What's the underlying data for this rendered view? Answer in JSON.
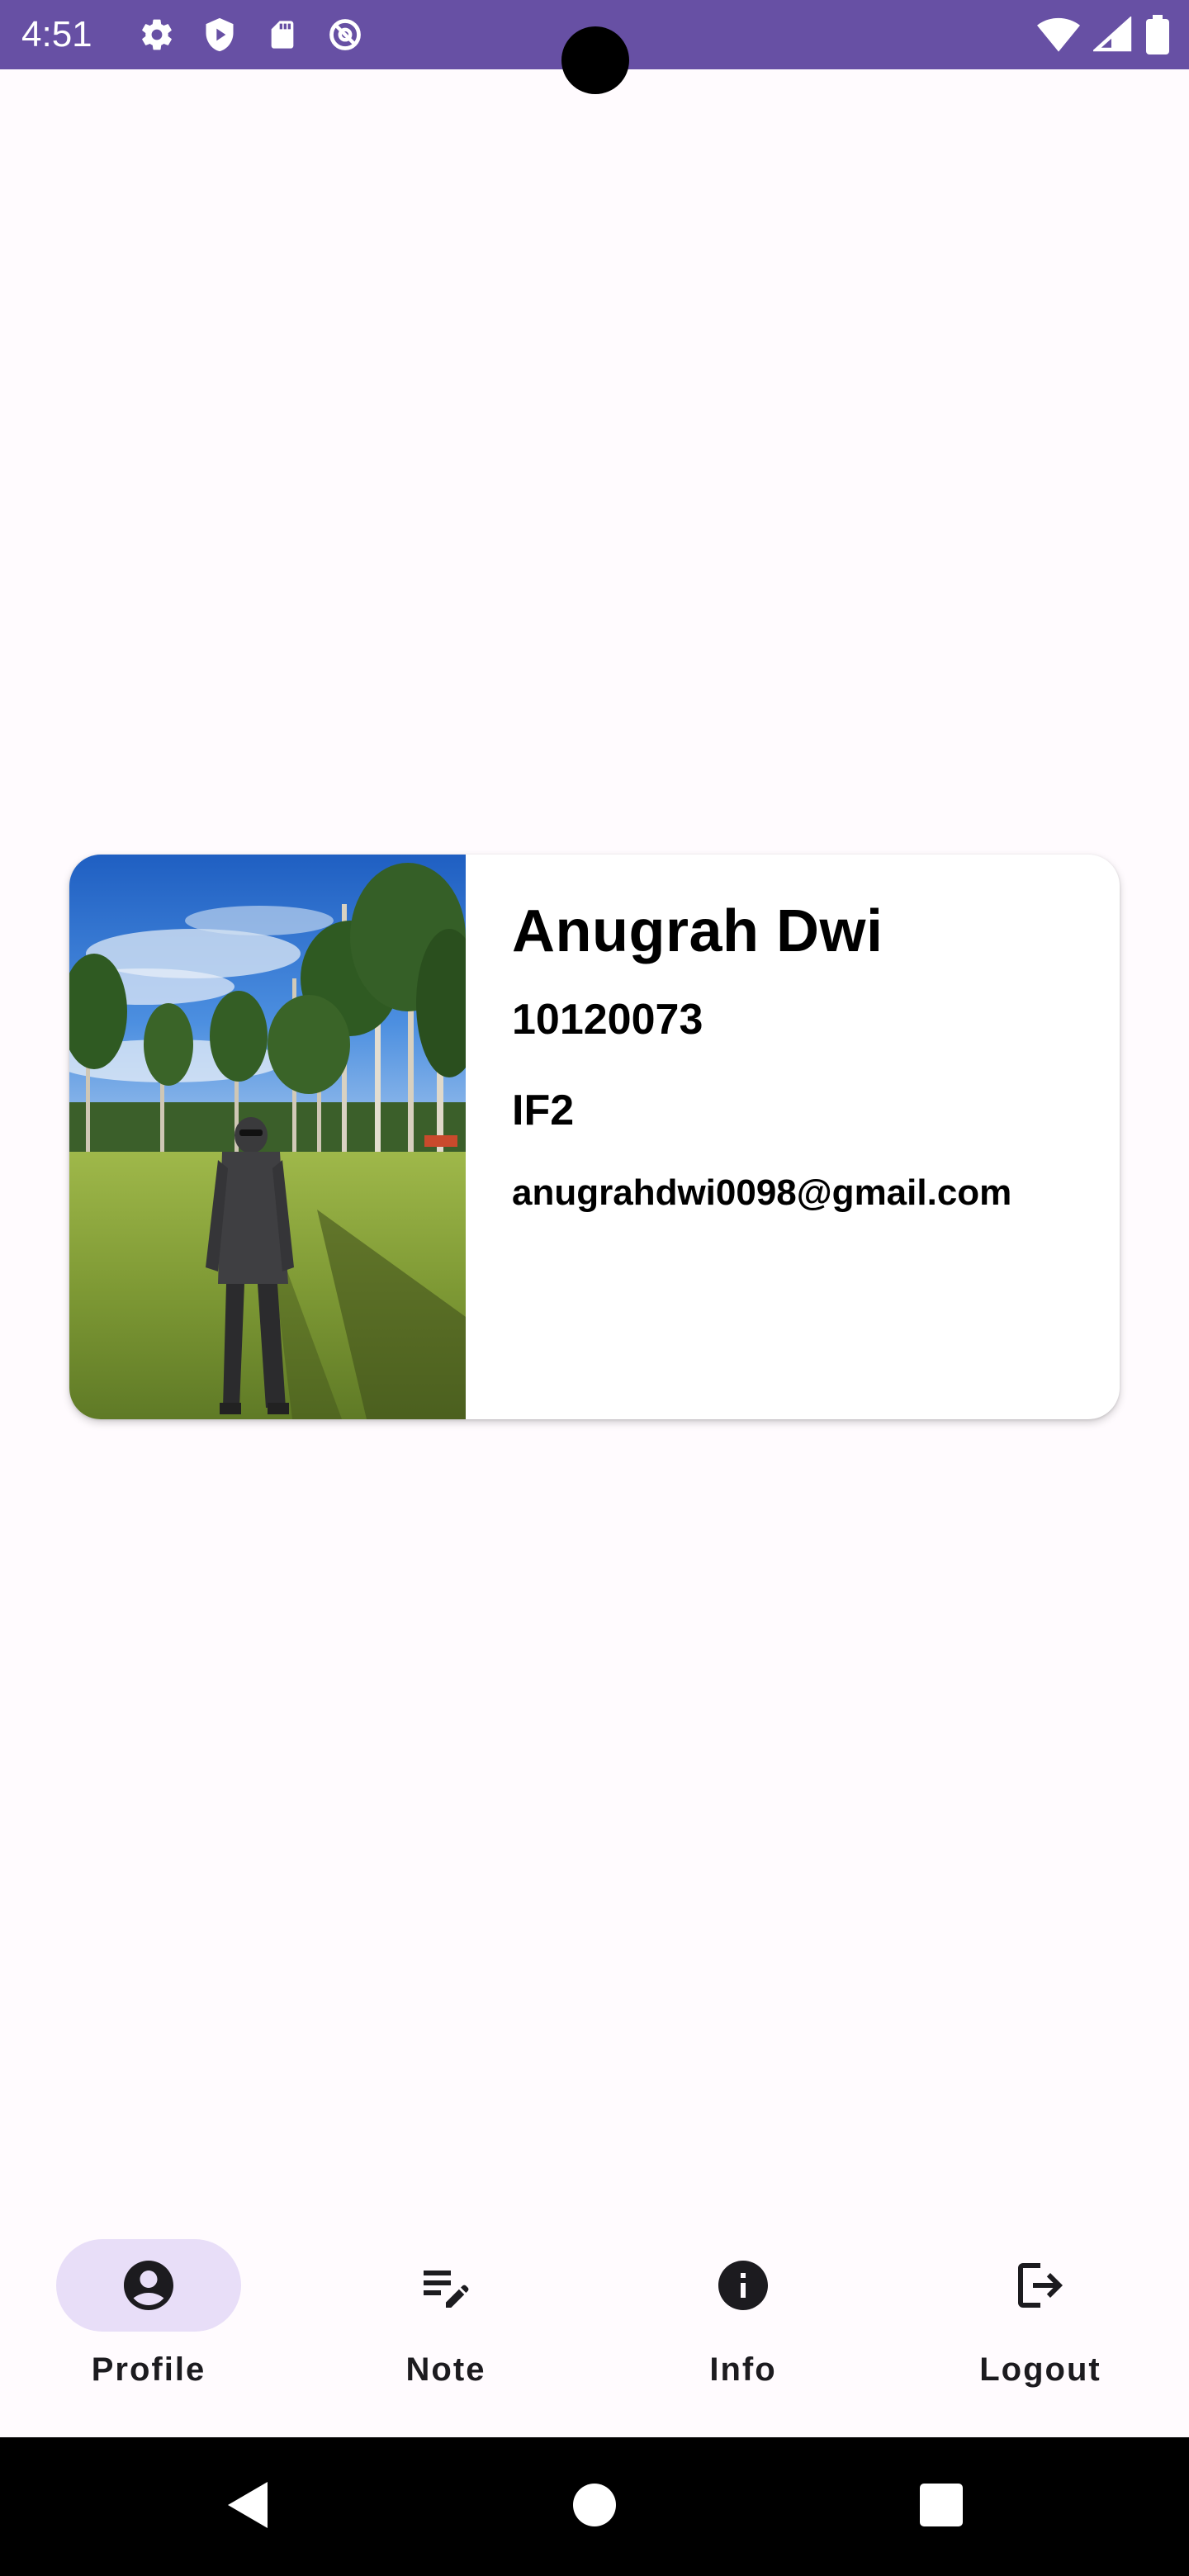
{
  "status_bar": {
    "time": "4:51",
    "icons_left": [
      "gear-icon",
      "shield-icon",
      "sd-card-icon",
      "at-sign-icon"
    ],
    "icons_right": [
      "wifi-icon",
      "signal-icon",
      "battery-icon"
    ],
    "background": "#6750a4"
  },
  "profile": {
    "name": "Anugrah Dwi",
    "nim": "10120073",
    "class": "IF2",
    "email": "anugrahdwi0098@gmail.com"
  },
  "bottom_nav": {
    "items": [
      {
        "label": "Profile",
        "icon": "account-circle-icon",
        "selected": true
      },
      {
        "label": "Note",
        "icon": "edit-note-icon",
        "selected": false
      },
      {
        "label": "Info",
        "icon": "info-icon",
        "selected": false
      },
      {
        "label": "Logout",
        "icon": "logout-icon",
        "selected": false
      }
    ],
    "indicator_color": "#e8def8"
  },
  "system_nav": {
    "buttons": [
      "back-icon",
      "home-icon",
      "recents-icon"
    ]
  }
}
